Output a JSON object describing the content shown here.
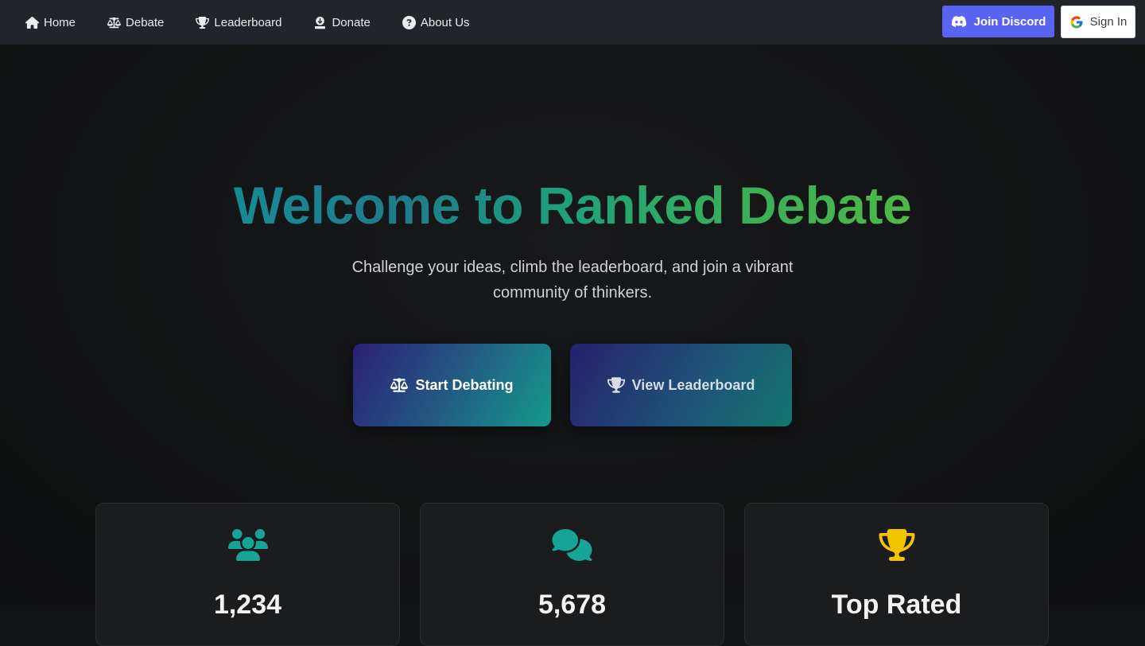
{
  "nav": {
    "items": [
      {
        "label": "Home",
        "icon": "home-icon"
      },
      {
        "label": "Debate",
        "icon": "balance-scale-icon"
      },
      {
        "label": "Leaderboard",
        "icon": "trophy-icon"
      },
      {
        "label": "Donate",
        "icon": "donate-icon"
      },
      {
        "label": "About Us",
        "icon": "question-circle-icon"
      }
    ],
    "discord_label": "Join Discord",
    "signin_label": "Sign In"
  },
  "hero": {
    "title": "Welcome to Ranked Debate",
    "subtitle": "Challenge your ideas, climb the leaderboard, and join a vibrant community of thinkers.",
    "start_label": "Start Debating",
    "leaderboard_label": "View Leaderboard"
  },
  "stats": [
    {
      "icon": "users-icon",
      "value": "1,234",
      "color": "#17a497"
    },
    {
      "icon": "comments-icon",
      "value": "5,678",
      "color": "#17a497"
    },
    {
      "icon": "trophy-icon",
      "value": "Top Rated",
      "color": "#f5c400"
    }
  ],
  "colors": {
    "navbar": "#212529",
    "discord": "#5865f2",
    "accent_teal": "#17a497",
    "accent_green": "#4fb847",
    "gold": "#f5c400"
  }
}
